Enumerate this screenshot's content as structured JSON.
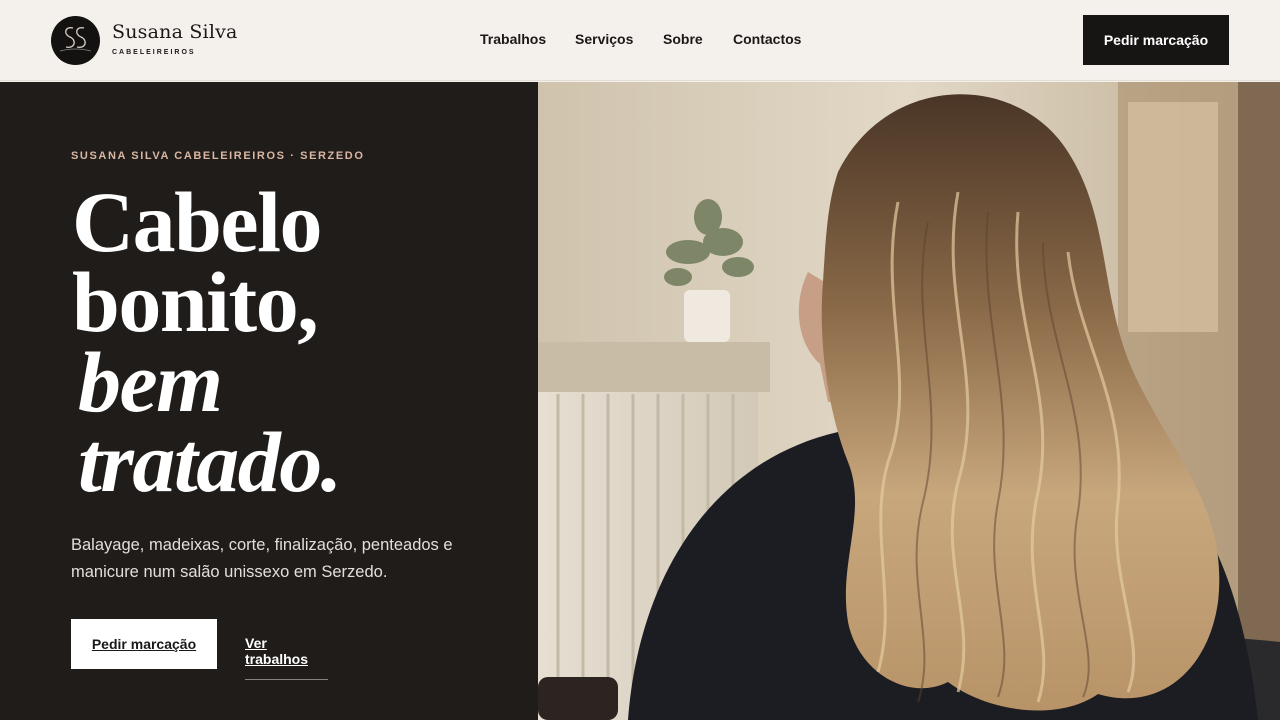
{
  "header": {
    "logo_monogram": "SS",
    "brand_name": "Susana Silva",
    "brand_sub": "CABELEIREIROS",
    "nav": [
      "Trabalhos",
      "Serviços",
      "Sobre",
      "Contactos"
    ],
    "cta_label": "Pedir marcação"
  },
  "hero": {
    "eyebrow": "SUSANA SILVA CABELEIREIROS · SERZEDO",
    "headline": [
      "Cabelo",
      "bonito,",
      "bem",
      "tratado."
    ],
    "lede": "Balayage, madeixas, corte, finalização, penteados e manicure num salão unissexo em Serzedo.",
    "primary_cta": "Pedir marcação",
    "secondary_link": "Ver trabalhos",
    "image_subject": "woman-with-balayage-hair-photo"
  },
  "colors": {
    "dark": "#201c1a",
    "light": "#f4f1ec",
    "accent": "#d8b8a4",
    "button_dark": "#171414"
  }
}
